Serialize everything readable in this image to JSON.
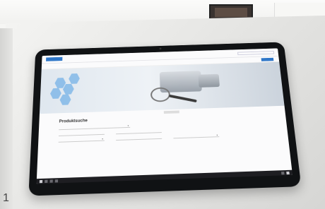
{
  "scene": {
    "page_number": "1"
  },
  "device_screen": {
    "logo_text": "",
    "nav_items": [
      "",
      "",
      "",
      "",
      "",
      ""
    ],
    "page_title": "Produktsuche",
    "field_labels": [
      "",
      "",
      "",
      ""
    ],
    "field_values": [
      "",
      "",
      "",
      "",
      "",
      ""
    ]
  },
  "colors": {
    "accent": "#2f77c8",
    "tablet_bezel": "#101214",
    "hero_hex": "#5aa3e4"
  }
}
